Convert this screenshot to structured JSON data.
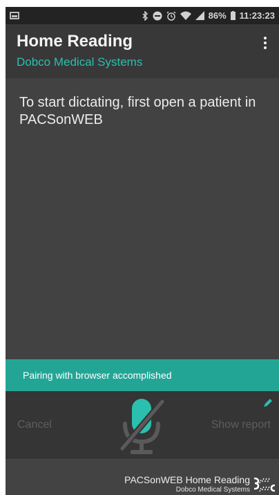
{
  "status_bar": {
    "battery_percent": "86%",
    "time": "11:23:23",
    "icons": [
      "gallery-icon",
      "bluetooth-icon",
      "do-not-disturb-icon",
      "alarm-icon",
      "wifi-icon",
      "signal-icon",
      "battery-icon"
    ]
  },
  "app_bar": {
    "title": "Home Reading",
    "subtitle": "Dobco Medical Systems",
    "menu_icon": "more-vert-icon"
  },
  "main": {
    "instruction": "To start dictating, first open a patient in PACSonWEB"
  },
  "snackbar": {
    "message": "Pairing with browser accomplished"
  },
  "action_bar": {
    "cancel_label": "Cancel",
    "show_report_label": "Show report",
    "mic_icon": "microphone-off-icon",
    "pen_icon": "pen-icon"
  },
  "footer": {
    "product_name": "PACSonWEB Home Reading",
    "company_name": "Dobco Medical Systems",
    "logo_icon": "dobco-logo-icon"
  },
  "colors": {
    "accent": "#2bbfae",
    "snackbar": "#23a596",
    "background": "#424242",
    "app_bar": "#383838",
    "disabled_text": "#5e5e5e"
  }
}
